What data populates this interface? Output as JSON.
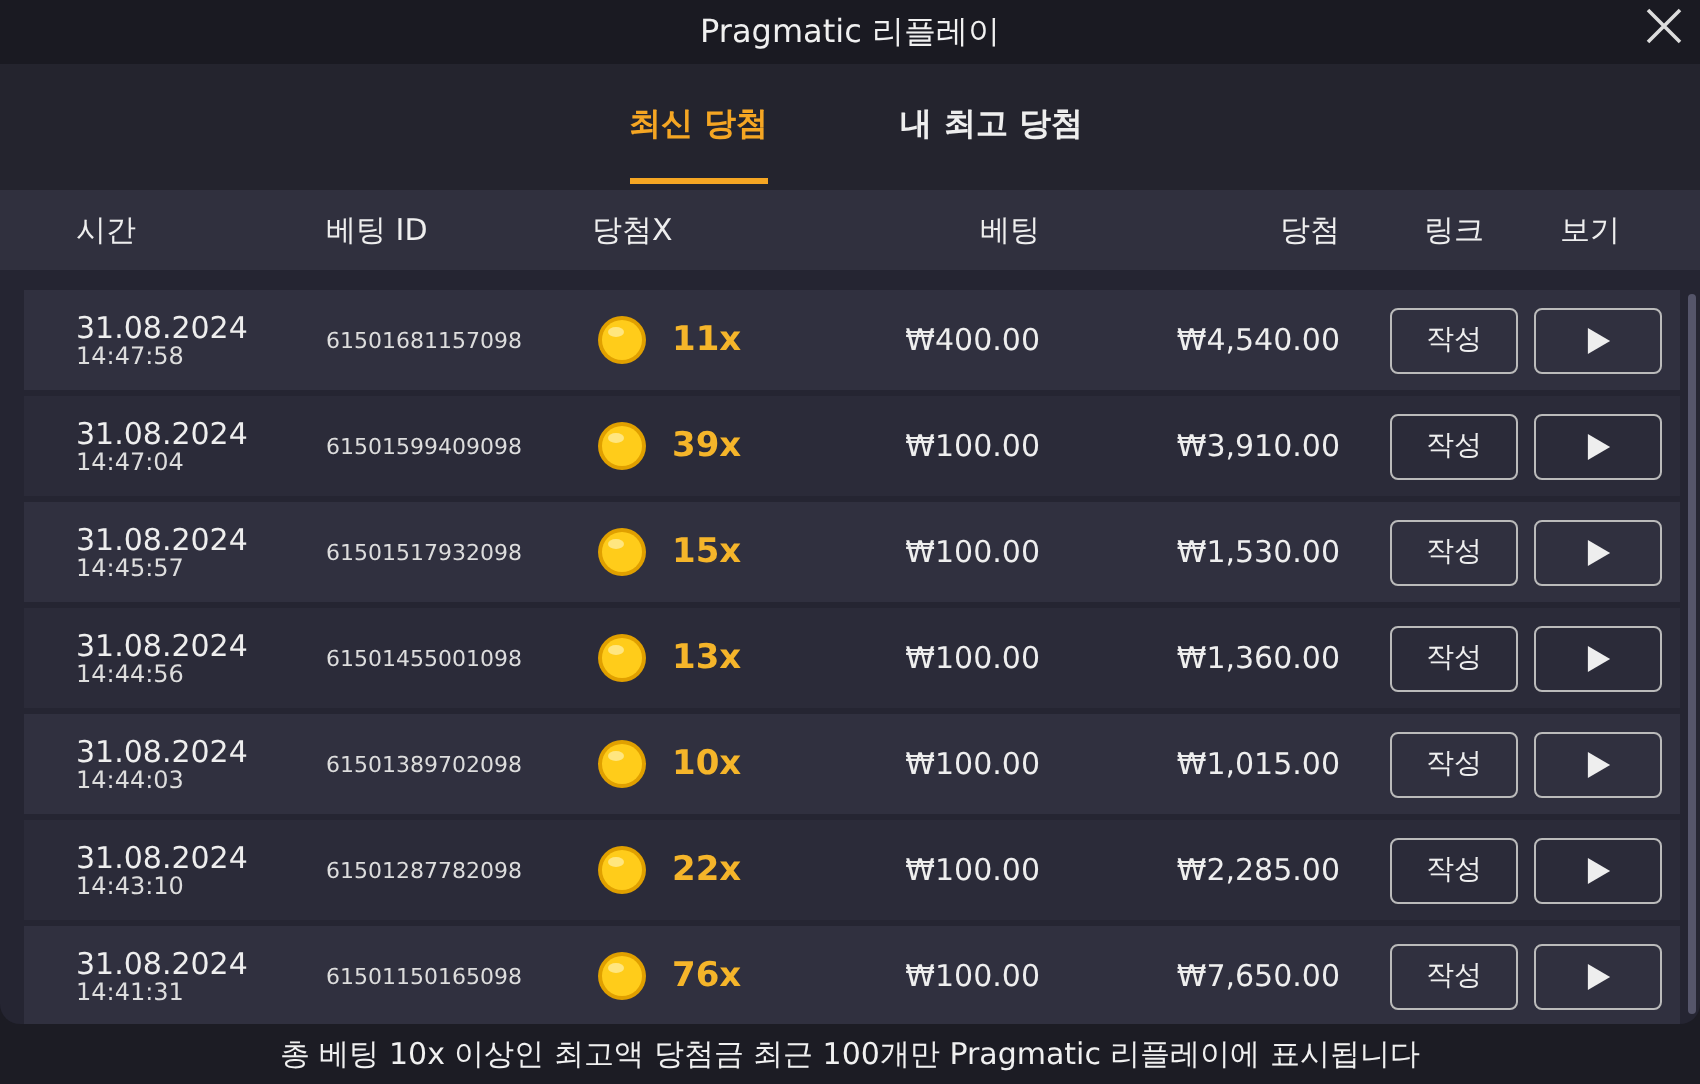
{
  "window": {
    "title": "Pragmatic 리플레이"
  },
  "tabs": [
    {
      "label": "최신 당첨",
      "selected": true
    },
    {
      "label": "내 최고 당첨",
      "selected": false
    }
  ],
  "table": {
    "columns": [
      "시간",
      "베팅 ID",
      "당첨X",
      "베팅",
      "당첨",
      "링크",
      "보기"
    ],
    "rows": [
      {
        "date": "31.08.2024",
        "time": "14:47:58",
        "bet_id": "61501681157098",
        "multiplier": "11x",
        "bet": "₩400.00",
        "win": "₩4,540.00",
        "link": "작성"
      },
      {
        "date": "31.08.2024",
        "time": "14:47:04",
        "bet_id": "61501599409098",
        "multiplier": "39x",
        "bet": "₩100.00",
        "win": "₩3,910.00",
        "link": "작성"
      },
      {
        "date": "31.08.2024",
        "time": "14:45:57",
        "bet_id": "61501517932098",
        "multiplier": "15x",
        "bet": "₩100.00",
        "win": "₩1,530.00",
        "link": "작성"
      },
      {
        "date": "31.08.2024",
        "time": "14:44:56",
        "bet_id": "61501455001098",
        "multiplier": "13x",
        "bet": "₩100.00",
        "win": "₩1,360.00",
        "link": "작성"
      },
      {
        "date": "31.08.2024",
        "time": "14:44:03",
        "bet_id": "61501389702098",
        "multiplier": "10x",
        "bet": "₩100.00",
        "win": "₩1,015.00",
        "link": "작성"
      },
      {
        "date": "31.08.2024",
        "time": "14:43:10",
        "bet_id": "61501287782098",
        "multiplier": "22x",
        "bet": "₩100.00",
        "win": "₩2,285.00",
        "link": "작성"
      },
      {
        "date": "31.08.2024",
        "time": "14:41:31",
        "bet_id": "61501150165098",
        "multiplier": "76x",
        "bet": "₩100.00",
        "win": "₩7,650.00",
        "link": "작성"
      }
    ]
  },
  "footer": "총 베팅 10x 이상인 최고액 당첨금 최근 100개만 Pragmatic 리플레이에 표시됩니다"
}
